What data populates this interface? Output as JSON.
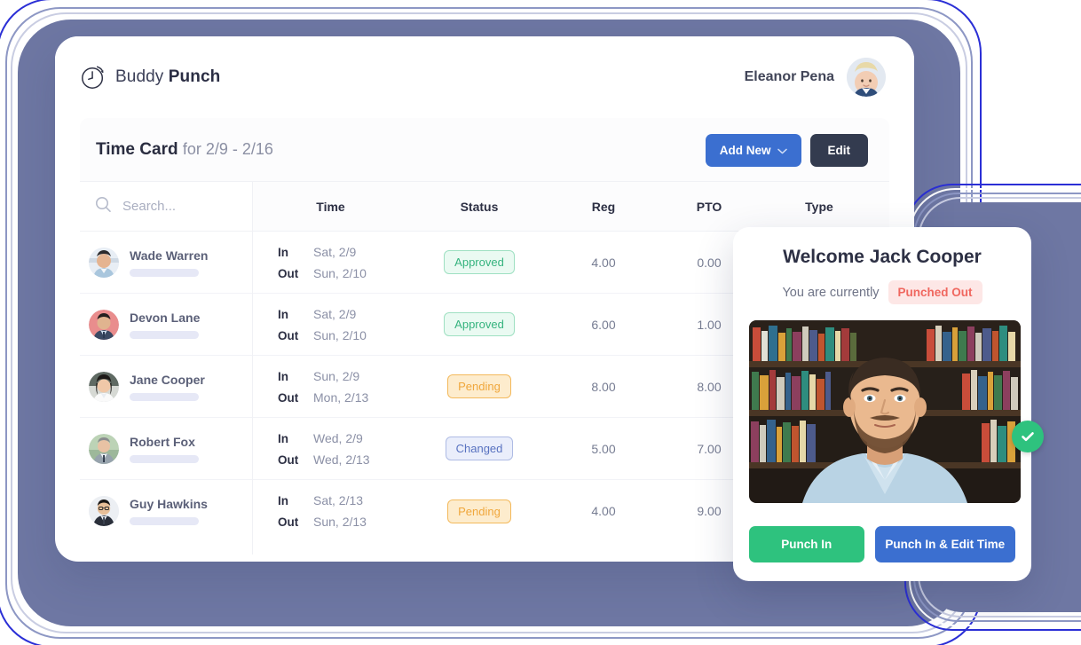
{
  "brand": {
    "word1": "Buddy",
    "word2": "Punch",
    "logo_icon": "clock-icon"
  },
  "header": {
    "user_name": "Eleanor Pena",
    "avatar_icon": "user-avatar"
  },
  "toolbar": {
    "title_strong": "Time Card",
    "title_light": "for 2/9 - 2/16",
    "add_new_label": "Add New",
    "add_new_icon": "chevron-down-icon",
    "edit_label": "Edit"
  },
  "search": {
    "placeholder": "Search...",
    "value": "",
    "icon": "search-icon"
  },
  "employees": [
    {
      "name": "Wade Warren"
    },
    {
      "name": "Devon Lane"
    },
    {
      "name": "Jane Cooper"
    },
    {
      "name": "Robert Fox"
    },
    {
      "name": "Guy Hawkins"
    }
  ],
  "table": {
    "headers": {
      "time": "Time",
      "status": "Status",
      "reg": "Reg",
      "pto": "PTO",
      "type": "Type"
    },
    "in_label": "In",
    "out_label": "Out",
    "rows": [
      {
        "in": "Sat, 2/9",
        "out": "Sun, 2/10",
        "status": "Approved",
        "status_kind": "approved",
        "reg": "4.00",
        "pto": "0.00",
        "type": ""
      },
      {
        "in": "Sat, 2/9",
        "out": "Sun, 2/10",
        "status": "Approved",
        "status_kind": "approved",
        "reg": "6.00",
        "pto": "1.00",
        "type": ""
      },
      {
        "in": "Sun, 2/9",
        "out": "Mon, 2/13",
        "status": "Pending",
        "status_kind": "pending",
        "reg": "8.00",
        "pto": "8.00",
        "type": ""
      },
      {
        "in": "Wed, 2/9",
        "out": "Wed, 2/13",
        "status": "Changed",
        "status_kind": "changed",
        "reg": "5.00",
        "pto": "7.00",
        "type": ""
      },
      {
        "in": "Sat, 2/13",
        "out": "Sun, 2/13",
        "status": "Pending",
        "status_kind": "pending",
        "reg": "4.00",
        "pto": "9.00",
        "type": ""
      }
    ]
  },
  "welcome": {
    "title": "Welcome Jack Cooper",
    "status_text": "You are currently",
    "status_badge": "Punched Out",
    "photo_alt": "webcam-photo",
    "check_icon": "check-circle-icon",
    "punch_in_label": "Punch In",
    "punch_in_edit_label": "Punch In & Edit Time"
  },
  "colors": {
    "primary_blue": "#3b6fd0",
    "dark_slate": "#333b4f",
    "green": "#2ec27e",
    "approved_green": "#35b37e",
    "pending_orange": "#f0a73c",
    "changed_blue": "#5872c0",
    "punched_out_red": "#f0675f",
    "deco_purple": "#6e77a3"
  }
}
